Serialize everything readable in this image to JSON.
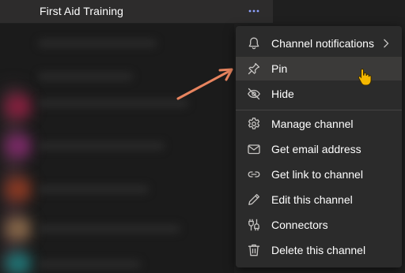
{
  "channel": {
    "name": "First Aid Training"
  },
  "menu": {
    "items": [
      {
        "label": "Channel notifications",
        "icon": "bell-icon",
        "submenu": true
      },
      {
        "label": "Pin",
        "icon": "pin-icon",
        "hovered": true
      },
      {
        "label": "Hide",
        "icon": "eye-hidden-icon"
      },
      {
        "label": "Manage channel",
        "icon": "gear-icon"
      },
      {
        "label": "Get email address",
        "icon": "envelope-icon"
      },
      {
        "label": "Get link to channel",
        "icon": "link-icon"
      },
      {
        "label": "Edit this channel",
        "icon": "pencil-icon"
      },
      {
        "label": "Connectors",
        "icon": "plug-icon"
      },
      {
        "label": "Delete this channel",
        "icon": "trash-icon"
      }
    ]
  },
  "colors": {
    "background": "#1f1f1f",
    "menu_background": "#2b2b2b",
    "hover_background": "#3b3a39",
    "arrow": "#e8845f",
    "cursor": "#f5b800",
    "text": "#ffffff",
    "icon": "#c8c6c4"
  }
}
